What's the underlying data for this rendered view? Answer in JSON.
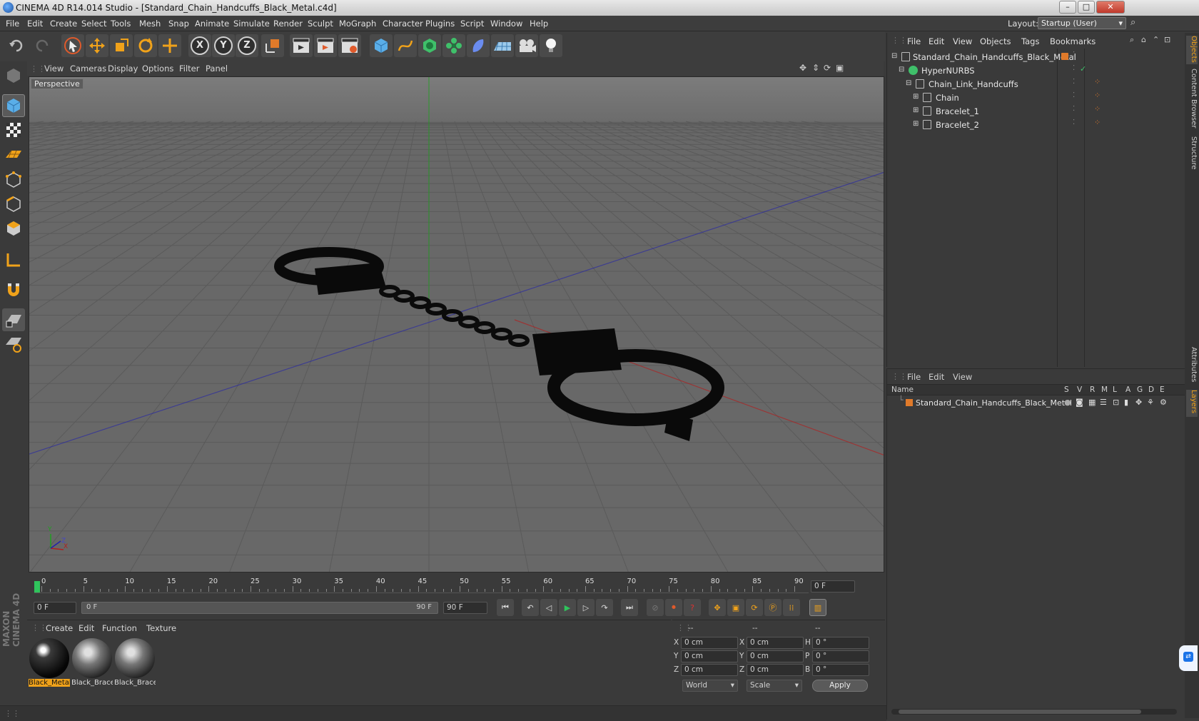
{
  "window": {
    "title": "CINEMA 4D R14.014 Studio - [Standard_Chain_Handcuffs_Black_Metal.c4d]"
  },
  "menubar": [
    "File",
    "Edit",
    "Create",
    "Select",
    "Tools",
    "Mesh",
    "Snap",
    "Animate",
    "Simulate",
    "Render",
    "Sculpt",
    "MoGraph",
    "Character",
    "Plugins",
    "Script",
    "Window",
    "Help"
  ],
  "layout": {
    "label": "Layout:",
    "value": "Startup (User)"
  },
  "toolbar": {
    "axis_x": "X",
    "axis_y": "Y",
    "axis_z": "Z"
  },
  "viewport": {
    "menu": [
      "View",
      "Cameras",
      "Display",
      "Options",
      "Filter",
      "Panel"
    ],
    "label": "Perspective"
  },
  "timeline": {
    "ticks": [
      "0",
      "5",
      "10",
      "15",
      "20",
      "25",
      "30",
      "35",
      "40",
      "45",
      "50",
      "55",
      "60",
      "65",
      "70",
      "75",
      "80",
      "85",
      "90"
    ],
    "current_frame": "0 F",
    "start_field": "0 F",
    "range_start": "0 F",
    "range_end": "90 F",
    "end_field": "90 F"
  },
  "materials": {
    "menu": [
      "Create",
      "Edit",
      "Function",
      "Texture"
    ],
    "items": [
      {
        "label": "Black_Metal"
      },
      {
        "label": "Black_Bracelet"
      },
      {
        "label": "Black_Bracelet"
      }
    ]
  },
  "coords": {
    "headers": [
      "--",
      "--",
      "--"
    ],
    "rows": [
      {
        "a": "X",
        "a_val": "0 cm",
        "b": "X",
        "b_val": "0 cm",
        "c": "H",
        "c_val": "0 °"
      },
      {
        "a": "Y",
        "a_val": "0 cm",
        "b": "Y",
        "b_val": "0 cm",
        "c": "P",
        "c_val": "0 °"
      },
      {
        "a": "Z",
        "a_val": "0 cm",
        "b": "Z",
        "b_val": "0 cm",
        "c": "B",
        "c_val": "0 °"
      }
    ],
    "space": "World",
    "mode": "Scale",
    "apply": "Apply"
  },
  "objects": {
    "menu": [
      "File",
      "Edit",
      "View",
      "Objects",
      "Tags",
      "Bookmarks"
    ],
    "tree": [
      {
        "name": "Standard_Chain_Handcuffs_Black_Metal"
      },
      {
        "name": "HyperNURBS"
      },
      {
        "name": "Chain_Link_Handcuffs"
      },
      {
        "name": "Chain"
      },
      {
        "name": "Bracelet_1"
      },
      {
        "name": "Bracelet_2"
      }
    ]
  },
  "layers": {
    "menu": [
      "File",
      "Edit",
      "View"
    ],
    "columns": [
      "Name",
      "S",
      "V",
      "R",
      "M",
      "L",
      "A",
      "G",
      "D",
      "E"
    ],
    "row": "Standard_Chain_Handcuffs_Black_Metal"
  },
  "sidetabs": [
    "Objects",
    "Content Browser",
    "Structure",
    "Attributes",
    "Layers"
  ],
  "brand": "MAXON CINEMA 4D"
}
